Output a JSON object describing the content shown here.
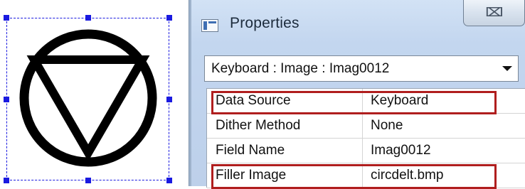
{
  "canvas": {
    "symbol": "circle-triangle-symbol",
    "selection_color": "#1a1ae0"
  },
  "properties_window": {
    "title": "Properties",
    "close_label": "⌧",
    "selector": {
      "value": "Keyboard : Image : Imag0012"
    },
    "rows": [
      {
        "name": "Data Source",
        "value": "Keyboard",
        "highlighted": true
      },
      {
        "name": "Dither Method",
        "value": "None",
        "highlighted": false
      },
      {
        "name": "Field Name",
        "value": "Imag0012",
        "highlighted": false
      },
      {
        "name": "Filler Image",
        "value": "circdelt.bmp",
        "highlighted": true
      }
    ],
    "highlight_color": "#b01e1e"
  }
}
